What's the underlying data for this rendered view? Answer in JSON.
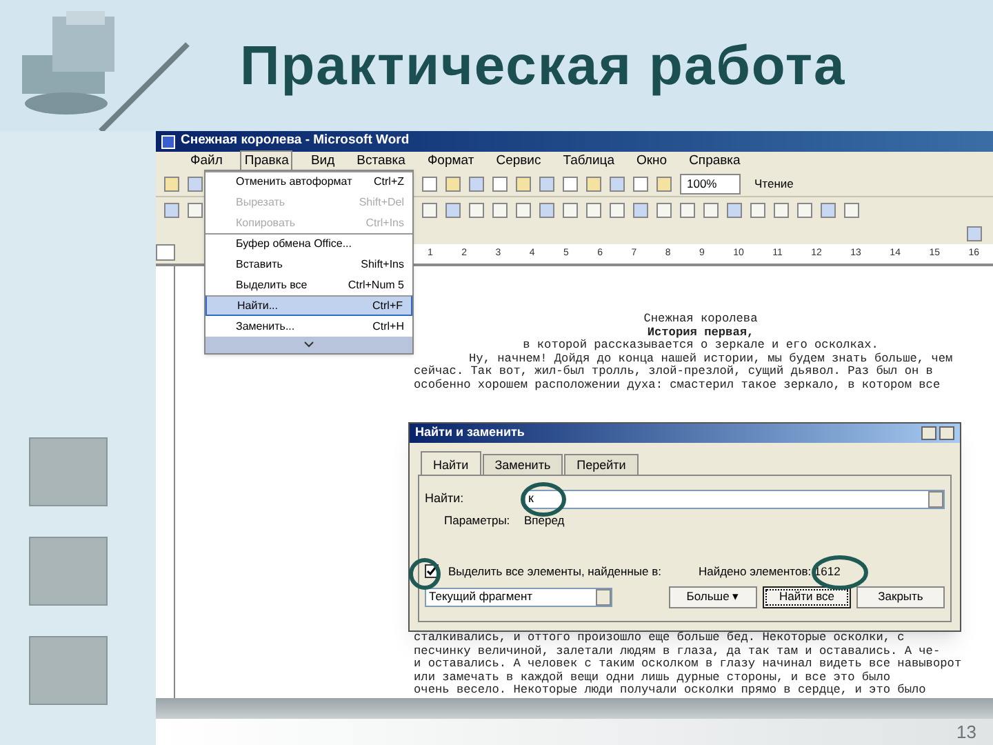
{
  "slide": {
    "title": "Практическая работа",
    "page_number": "13"
  },
  "window": {
    "title": "Снежная королева - Microsoft Word"
  },
  "menu_bar": [
    {
      "label": "Файл",
      "selected": false
    },
    {
      "label": "Правка",
      "selected": true
    },
    {
      "label": "Вид",
      "selected": false
    },
    {
      "label": "Вставка",
      "selected": false
    },
    {
      "label": "Формат",
      "selected": false
    },
    {
      "label": "Сервис",
      "selected": false
    },
    {
      "label": "Таблица",
      "selected": false
    },
    {
      "label": "Окно",
      "selected": false
    },
    {
      "label": "Справка",
      "selected": false
    }
  ],
  "edit_menu": [
    {
      "label": "Отменить автоформат",
      "shortcut": "Ctrl+Z",
      "disabled": false,
      "selected": false
    },
    {
      "label": "Вырезать",
      "shortcut": "Shift+Del",
      "disabled": true,
      "selected": false
    },
    {
      "label": "Копировать",
      "shortcut": "Ctrl+Ins",
      "disabled": true,
      "selected": false
    },
    {
      "label": "Буфер обмена Office...",
      "disabled": false,
      "selected": false
    },
    {
      "label": "Вставить",
      "shortcut": "Shift+Ins",
      "disabled": false,
      "selected": false
    },
    {
      "label": "Выделить все",
      "shortcut": "Ctrl+Num 5",
      "disabled": false,
      "selected": false
    },
    {
      "label": "Найти...",
      "shortcut": "Ctrl+F",
      "disabled": false,
      "selected": true
    },
    {
      "label": "Заменить...",
      "shortcut": "Ctrl+H",
      "disabled": false,
      "selected": false
    }
  ],
  "toolbar": {
    "zoom": "100%",
    "reading": "Чтение"
  },
  "ruler": [
    "1",
    "2",
    "3",
    "4",
    "5",
    "6",
    "7",
    "8",
    "9",
    "10",
    "11",
    "12",
    "13",
    "14",
    "15",
    "16"
  ],
  "document": {
    "lines_above": [
      {
        "kind": "center",
        "text": "Снежная королева"
      },
      {
        "kind": "heading",
        "text": "История первая,"
      },
      {
        "kind": "center",
        "text": "в которой рассказывается о зеркале и его осколках."
      },
      {
        "kind": "indent",
        "text": "Ну, начнем! Дойдя до конца нашей истории, мы будем знать больше, чем"
      },
      {
        "kind": "plain",
        "text": "сейчас. Так вот, жил-был тролль, злой-презлой, сущий дьявол. Раз был он в"
      },
      {
        "kind": "plain",
        "text": "особенно хорошем расположении духа: смастерил такое зеркало, в котором все"
      }
    ],
    "lines_below": [
      "сталкивались, и оттого произошло еще больше бед. Некоторые осколки, с",
      "песчинку величиной, залетали людям в глаза, да так там и оставались. А че-",
      "и оставались. А человек с таким осколком в глазу начинал видеть все навыворот",
      "или замечать в каждой вещи одни лишь дурные стороны, и все это было",
      "очень весело. Некоторые люди получали осколки прямо в сердце, и это было"
    ]
  },
  "dialog": {
    "title": "Найти и заменить",
    "tabs": [
      {
        "label": "Найти",
        "selected": true
      },
      {
        "label": "Заменить",
        "selected": false
      },
      {
        "label": "Перейти",
        "selected": false
      }
    ],
    "find_label": "Найти:",
    "find_value": "к",
    "options_label": "Параметры:",
    "options_value": "Вперед",
    "highlight": {
      "label": "Выделить все элементы, найденные в:",
      "checked": true
    },
    "scope": "Текущий фрагмент",
    "found": "Найдено элементов: 1612",
    "buttons": [
      {
        "label": "Больше ▾",
        "selected": false
      },
      {
        "label": "Найти все",
        "selected": true
      },
      {
        "label": "Закрыть",
        "selected": false
      }
    ]
  }
}
